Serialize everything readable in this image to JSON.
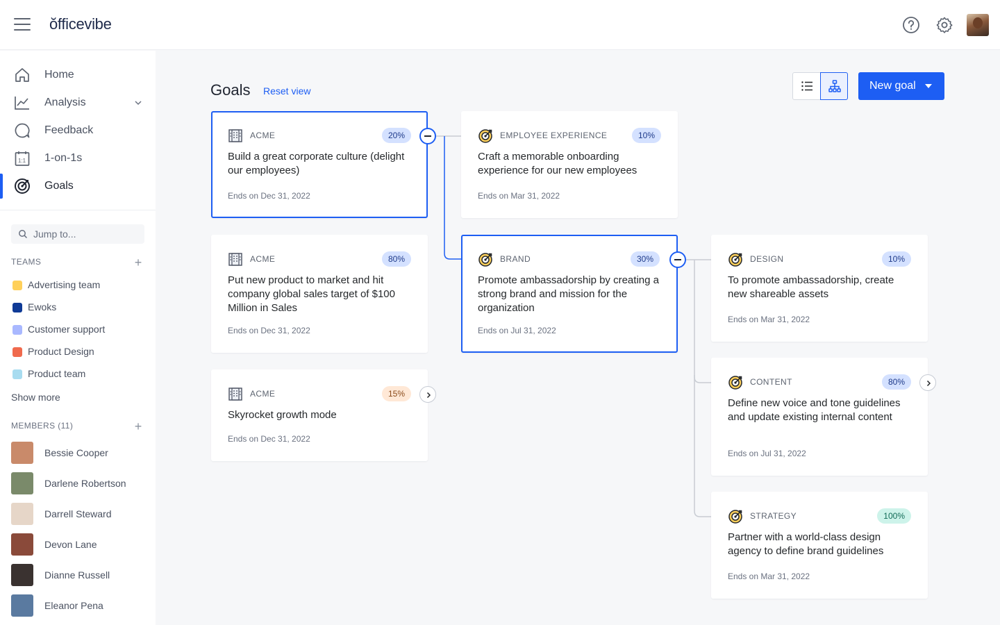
{
  "app": {
    "logo": "ŏfficevibe"
  },
  "sidebar": {
    "nav": [
      {
        "label": "Home",
        "icon": "home-icon"
      },
      {
        "label": "Analysis",
        "icon": "line-chart-icon"
      },
      {
        "label": "Feedback",
        "icon": "chat-bubble-icon"
      },
      {
        "label": "1-on-1s",
        "icon": "calendar-icon"
      },
      {
        "label": "Goals",
        "icon": "target-icon",
        "active": true
      }
    ],
    "jump_placeholder": "Jump to...",
    "teams_label": "TEAMS",
    "teams": [
      {
        "label": "Advertising team",
        "color": "#ffd05a"
      },
      {
        "label": "Ewoks",
        "color": "#0f3a96"
      },
      {
        "label": "Customer support",
        "color": "#a9b8ff"
      },
      {
        "label": "Product Design",
        "color": "#f06a4d"
      },
      {
        "label": "Product team",
        "color": "#a8dcf0"
      }
    ],
    "show_more": "Show more",
    "members_label": "MEMBERS (11)",
    "members": [
      {
        "name": "Bessie Cooper"
      },
      {
        "name": "Darlene Robertson"
      },
      {
        "name": "Darrell Steward"
      },
      {
        "name": "Devon Lane"
      },
      {
        "name": "Dianne Russell"
      },
      {
        "name": "Eleanor Pena"
      }
    ]
  },
  "main": {
    "title": "Goals",
    "reset_view": "Reset view",
    "new_goal": "New goal"
  },
  "goals": [
    {
      "category": "ACME",
      "icon": "building-icon",
      "progress": "20%",
      "badge_color": "blue",
      "title": "Build a great corporate culture (delight our employees)",
      "ends": "Ends on Dec 31, 2022",
      "selected": true
    },
    {
      "category": "ACME",
      "icon": "building-icon",
      "progress": "80%",
      "badge_color": "blue",
      "title": "Put new product to market and hit company global sales target of $100 Million in Sales",
      "ends": "Ends on Dec 31, 2022"
    },
    {
      "category": "ACME",
      "icon": "building-icon",
      "progress": "15%",
      "badge_color": "orange",
      "title": "Skyrocket growth mode",
      "ends": "Ends on Dec 31, 2022"
    },
    {
      "category": "EMPLOYEE EXPERIENCE",
      "icon": "target-icon",
      "progress": "10%",
      "badge_color": "blue",
      "title": "Craft a memorable onboarding experience for our new employees",
      "ends": "Ends on Mar 31, 2022"
    },
    {
      "category": "BRAND",
      "icon": "target-icon",
      "progress": "30%",
      "badge_color": "blue",
      "title": "Promote ambassadorship by creating a strong brand and mission for the organization",
      "ends": "Ends on Jul 31, 2022",
      "selected": true
    },
    {
      "category": "DESIGN",
      "icon": "target-icon",
      "progress": "10%",
      "badge_color": "blue",
      "title": "To promote ambassadorship, create new shareable assets",
      "ends": "Ends on Mar 31, 2022"
    },
    {
      "category": "CONTENT",
      "icon": "target-icon",
      "progress": "80%",
      "badge_color": "blue",
      "title": "Define new voice and tone guidelines and update existing internal content",
      "ends": "Ends on Jul 31, 2022"
    },
    {
      "category": "STRATEGY",
      "icon": "target-icon",
      "progress": "100%",
      "badge_color": "teal",
      "title": "Partner with a world-class design agency to define brand guidelines",
      "ends": "Ends on Mar 31, 2022"
    }
  ]
}
